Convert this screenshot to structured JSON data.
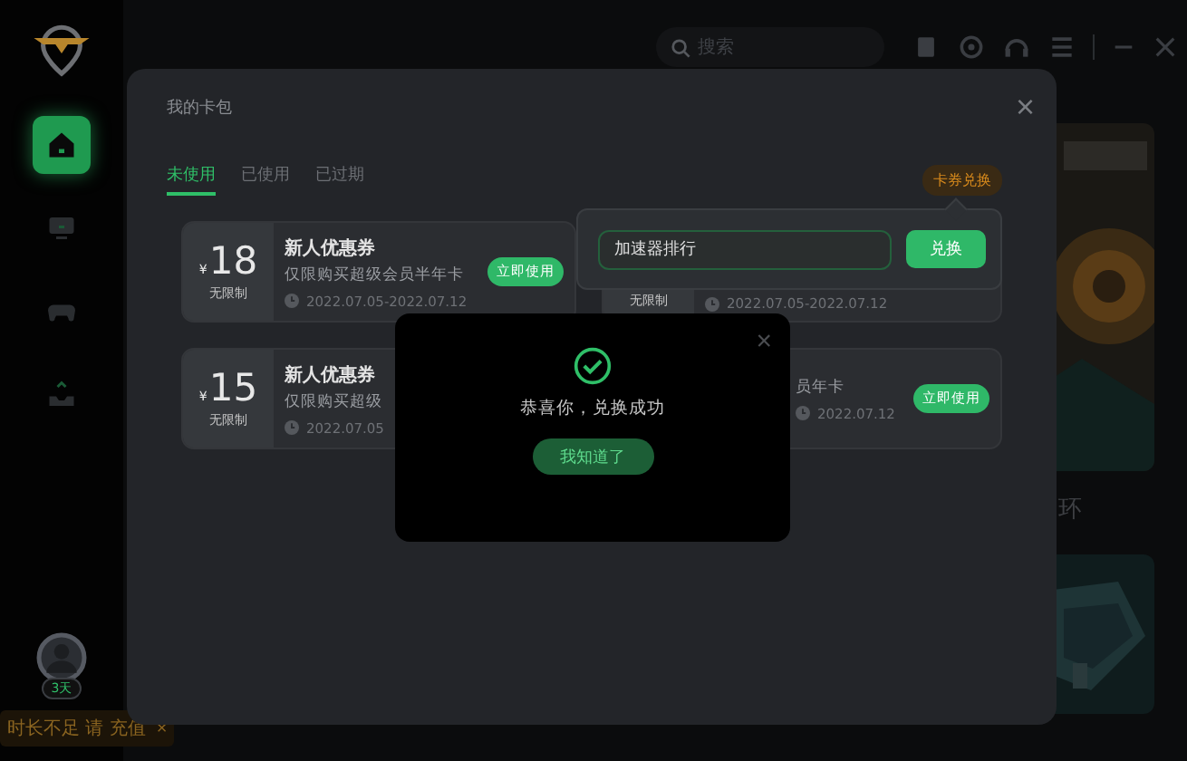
{
  "sidebar": {
    "items": [
      {
        "kind": "home",
        "selected": true
      },
      {
        "kind": "monitor",
        "selected": false
      },
      {
        "kind": "gamepad",
        "selected": false
      },
      {
        "kind": "inbox",
        "selected": false
      }
    ],
    "avatar_badge": "3天",
    "tooltip": {
      "text": "时长不足 请 充值",
      "close": "×"
    }
  },
  "topbar": {
    "search": {
      "placeholder": "搜索"
    }
  },
  "background": {
    "caption": "环"
  },
  "modal": {
    "title": "我的卡包",
    "close": "×",
    "tabs": [
      {
        "label": "未使用",
        "selected": true
      },
      {
        "label": "已使用",
        "selected": false
      },
      {
        "label": "已过期",
        "selected": false
      }
    ],
    "redeem_button": "卡券兑换",
    "coupons": [
      {
        "kind": "full",
        "currency": "¥",
        "amount": "18",
        "limit": "无限制",
        "title": "新人优惠券",
        "desc": "仅限购买超级会员半年卡",
        "date": "2022.07.05-2022.07.12",
        "button": "立即使用"
      },
      {
        "kind": "covered",
        "limit": "无限制",
        "date": "2022.07.05-2022.07.12"
      },
      {
        "kind": "full",
        "currency": "¥",
        "amount": "15",
        "limit": "无限制",
        "title": "新人优惠券",
        "desc": "仅限购买超级",
        "date": "2022.07.05"
      },
      {
        "kind": "tail",
        "desc": "员年卡",
        "date": "2022.07.12",
        "button": "立即使用"
      }
    ],
    "popover": {
      "value": "加速器排行",
      "button": "兑换"
    },
    "dialog": {
      "close": "×",
      "message": "恭喜你，兑换成功",
      "button": "我知道了"
    }
  }
}
